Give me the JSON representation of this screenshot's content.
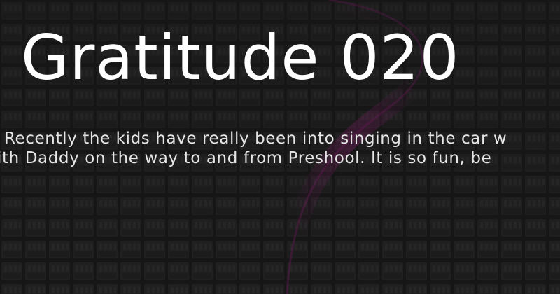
{
  "card": {
    "title": "Gratitude 020",
    "excerpt_line_1": "Recently the kids have really been into singing in the car w",
    "excerpt_line_2": "ith Daddy on the way to and from Preshool.  It is so fun, be"
  },
  "colors": {
    "background": "#171717",
    "pattern": "#262626",
    "accent_glow": "#b0218c",
    "title_text": "#ffffff",
    "body_text": "#e6e6e6"
  }
}
